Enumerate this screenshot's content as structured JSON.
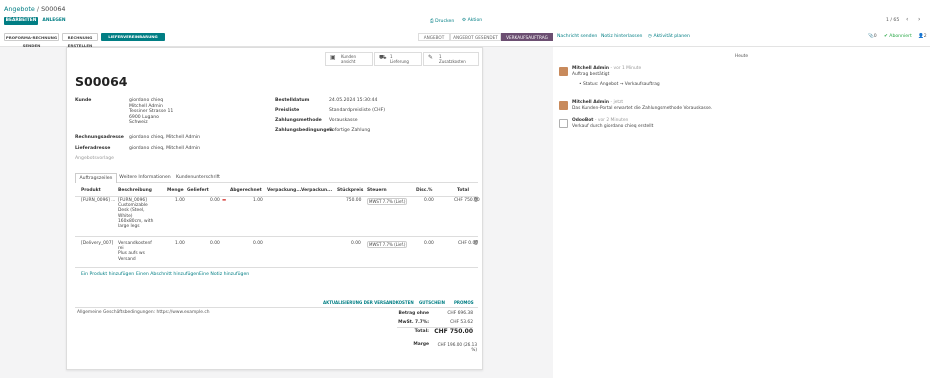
{
  "breadcrumb": {
    "parent": "Angebote",
    "sep": "/",
    "current": "S00064"
  },
  "toolbar": {
    "edit_label": "BEARBEITEN",
    "create_label": "ANLEGEN",
    "print_label": "⎙ Drucken",
    "action_label": "⚙ Aktion",
    "pager": "1 / 65"
  },
  "actions": [
    {
      "label": "PROFORMA-RECHNUNG SENDEN"
    },
    {
      "label": "RECHNUNG ERSTELLEN"
    },
    {
      "label": "LIEFERVEREINBARUNG BESTÄTIGEN"
    }
  ],
  "stages": [
    {
      "label": "ANGEBOT",
      "active": false
    },
    {
      "label": "ANGEBOT GESENDET",
      "active": false
    },
    {
      "label": "VERKAUFSAUFTRAG",
      "active": true
    }
  ],
  "chatter_top": {
    "send_message": "Nachricht senden",
    "log_note": "Notiz hinterlassen",
    "schedule": "◷ Aktivität planen",
    "followers_count": "0",
    "follow_label": "✔ Abonniert",
    "members_count": "2"
  },
  "smart_buttons": [
    {
      "icon": "▣",
      "line1": "Kunden",
      "line2": "ansicht"
    },
    {
      "icon": "⛟",
      "line1": "1",
      "line2": "Lieferung"
    },
    {
      "icon": "✎",
      "line1": "1",
      "line2": "Zusatzkosten"
    }
  ],
  "order": {
    "name": "S00064",
    "customer_label": "Kunde",
    "customer_name": "giordano chieq",
    "customer_address": [
      "Mitchell Admin",
      "Tessiner Strasse 11",
      "6900 Lugano",
      "Schweiz"
    ],
    "invoice_label": "Rechnungsadresse",
    "invoice_value": "giordano chieq, Mitchell Admin",
    "delivery_label": "Lieferadresse",
    "delivery_value": "giordano chieq, Mitchell Admin",
    "quote_template": "Angebotsvorlage",
    "date_label": "Bestelldatum",
    "date_value": "24.05.2024 15:30:44",
    "pricelist_label": "Preisliste",
    "pricelist_value": "Standardpreisliste (CHF)",
    "payment_method_label": "Zahlungsmethode",
    "payment_method_value": "Vorauskasse",
    "payment_terms_label": "Zahlungsbedingungen",
    "payment_terms_value": "Sofortige Zahlung"
  },
  "tabs": [
    {
      "label": "Auftragszeilen"
    },
    {
      "label": "Weitere Informationen"
    },
    {
      "label": "Kundenunterschrift"
    }
  ],
  "table": {
    "headers": [
      "Produkt",
      "Beschreibung",
      "Menge",
      "Geliefert",
      "Abgerechnet",
      "Verpackung...",
      "Verpackun...",
      "Stückpreis",
      "Steuern",
      "Disc.%",
      "Total"
    ],
    "rows": [
      {
        "product": "[FURN_0096] ...",
        "description": [
          "[FURN_0096]",
          "Customizable",
          "Desk (Steel,",
          "White)",
          "160x80cm, with",
          "large legs"
        ],
        "qty": "1.00",
        "delivered": "0.00",
        "invoiced": "1.00",
        "price": "750.00",
        "taxes": "MWST 7.7% (Lief.)",
        "disc": "0.00",
        "total": "CHF 750.00"
      },
      {
        "product": "[Delivery_007]",
        "description": [
          "Versandkostenf",
          "rei",
          "Plus aufs ws",
          "Versand"
        ],
        "qty": "1.00",
        "delivered": "0.00",
        "invoiced": "0.00",
        "price": "0.00",
        "taxes": "MWST 7.7% (Lief.)",
        "disc": "0.00",
        "total": "CHF 0.00"
      }
    ],
    "add_links": [
      "Ein Produkt hinzufügen",
      "Einen Abschnitt hinzufügen",
      "Eine Notiz hinzufügen"
    ]
  },
  "bottom_buttons": [
    "AKTUALISIERUNG DER VERSANDKOSTEN",
    "GUTSCHEIN",
    "PROMOS"
  ],
  "terms": "Allgemeine Geschäftsbedingungen: https://www.example.ch",
  "totals": {
    "untaxed_label": "Betrag ohne",
    "untaxed_value": "CHF 696.38",
    "tax_label": "MwSt. 7.7%:",
    "tax_value": "CHF 53.62",
    "total_label": "Total:",
    "total_value": "CHF 750.00",
    "margin_label": "Marge",
    "margin_value": "CHF 196.00 (26.13 %)"
  },
  "chatter": {
    "date_divider": "Heute",
    "messages": [
      {
        "author": "Mitchell Admin",
        "date": "- vor 1 Minute",
        "body": "Auftrag bestätigt",
        "tracking": "Status: Angebot → Verkaufsauftrag"
      },
      {
        "author": "Mitchell Admin",
        "date": "- jetzt",
        "body": "Das Kunden-Portal erwartet die Zahlungsmethode Vorauskasse."
      },
      {
        "author": "OdooBot",
        "date": "- vor 2 Minuten",
        "body": "Verkauf durch giordano chieq erstellt"
      }
    ]
  }
}
